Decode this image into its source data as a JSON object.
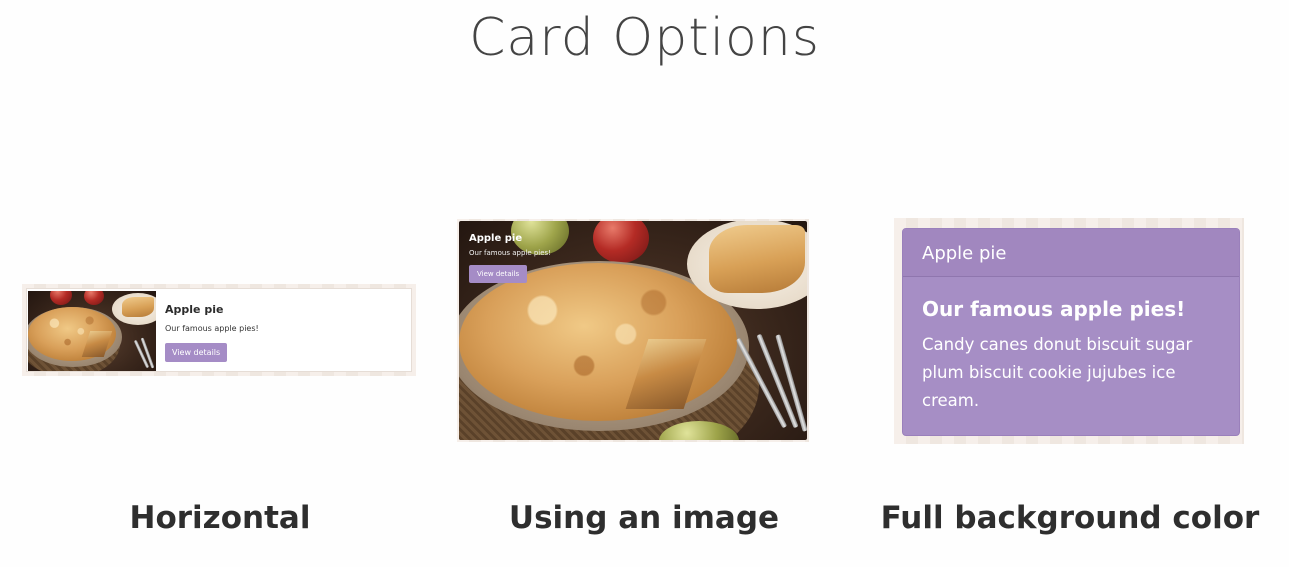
{
  "page": {
    "title": "Card Options"
  },
  "captions": {
    "horizontal": "Horizontal",
    "image": "Using an image",
    "color": "Full background color"
  },
  "horizontal_card": {
    "title": "Apple pie",
    "text": "Our famous apple pies!",
    "button_label": "View details",
    "image": "apple-pie-image"
  },
  "image_card": {
    "title": "Apple pie",
    "text": "Our famous apple pies!",
    "button_label": "View details",
    "image": "apple-pie-image"
  },
  "color_card": {
    "header": "Apple pie",
    "heading": "Our famous apple pies!",
    "paragraph": "Candy canes donut biscuit sugar plum biscuit cookie jujubes ice cream."
  },
  "colors": {
    "accent_purple": "#a68ec5",
    "button_purple": "#a58cc6",
    "backdrop_stripe_light": "#f6efea",
    "backdrop_stripe_dark": "#efe7e0"
  }
}
